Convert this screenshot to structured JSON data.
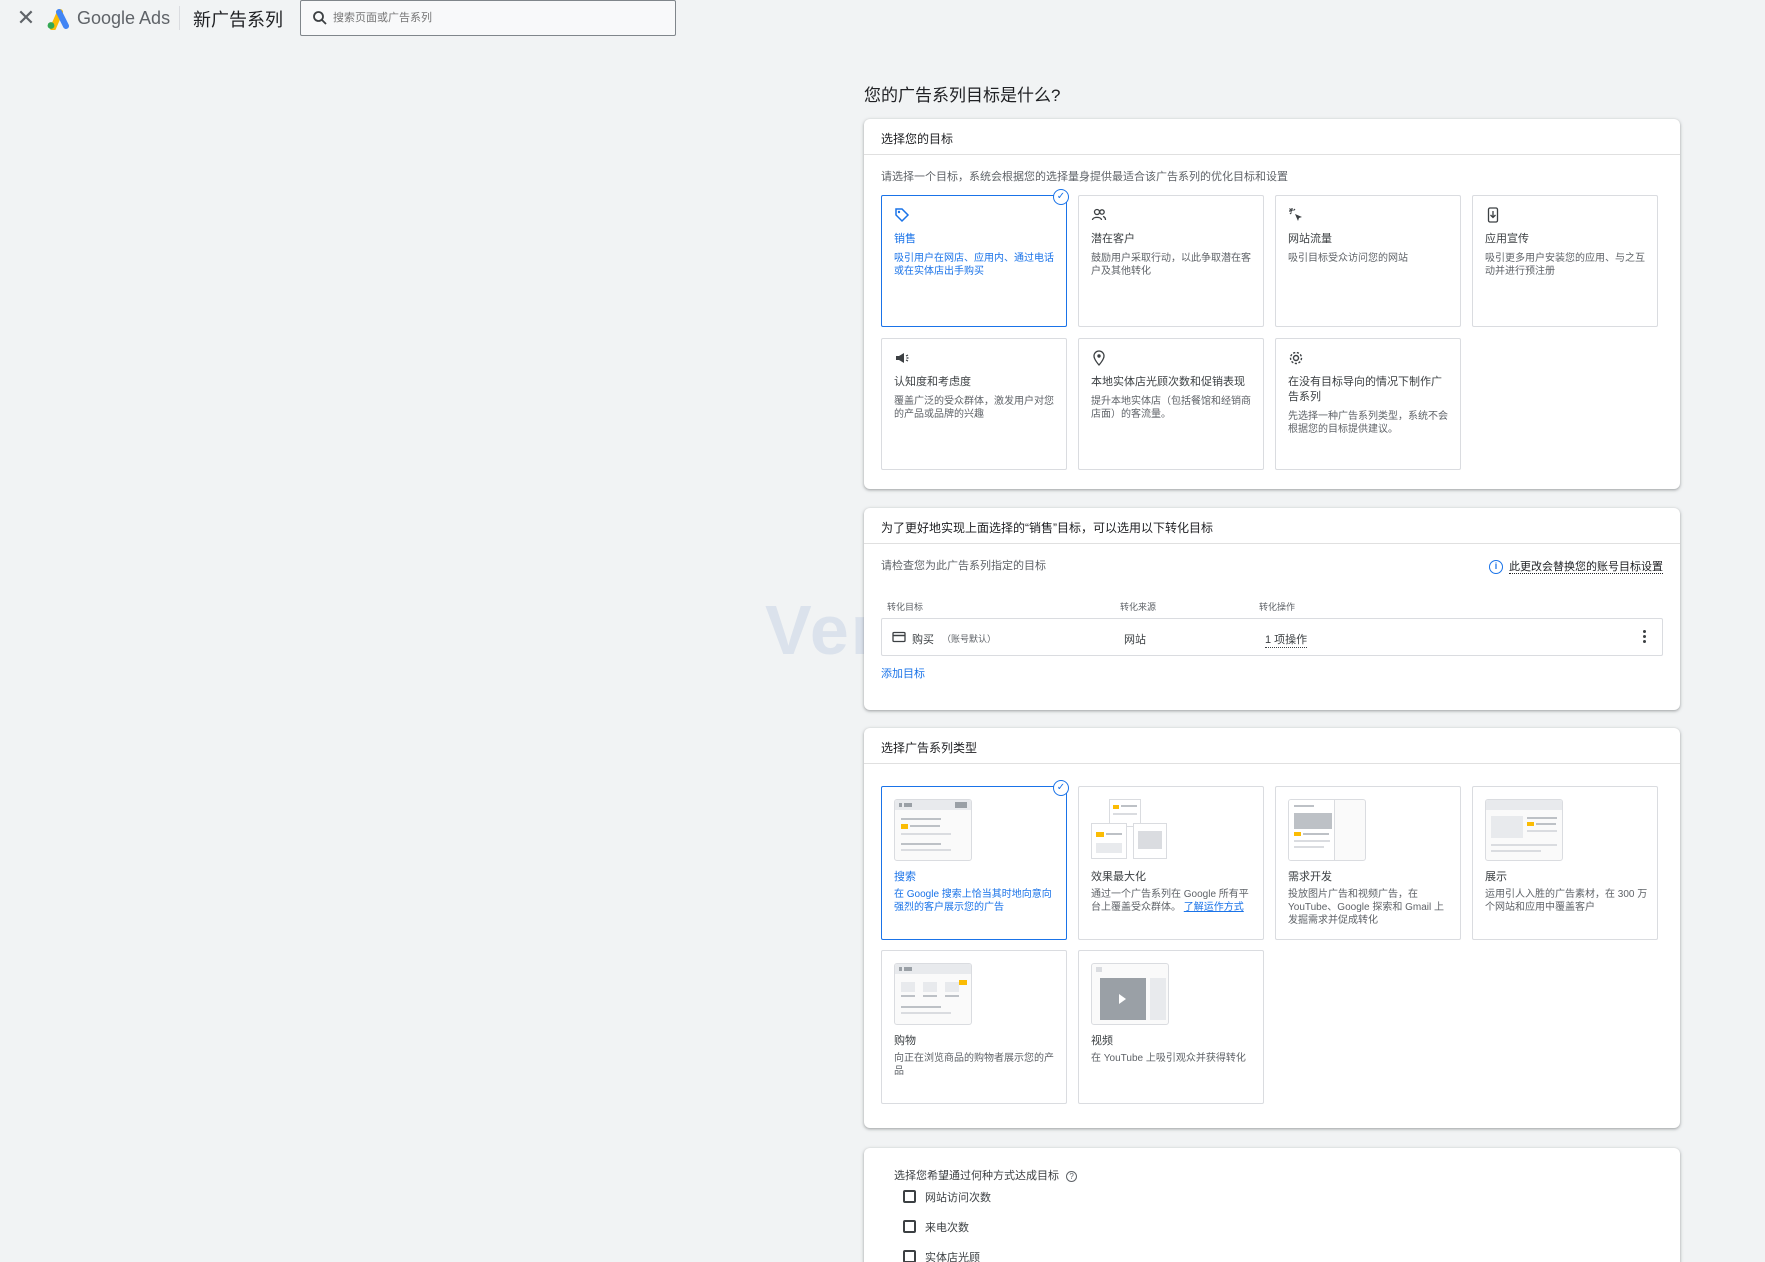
{
  "header": {
    "close_icon": "close-icon",
    "brand": "Google Ads",
    "page_title": "新广告系列",
    "search_placeholder": "搜索页面或广告系列"
  },
  "main_title": "您的广告系列目标是什么?",
  "goal_section": {
    "heading": "选择您的目标",
    "subtitle": "请选择一个目标，系统会根据您的选择量身提供最适合该广告系列的优化目标和设置",
    "tiles": [
      {
        "icon": "tag-icon",
        "title": "销售",
        "desc": "吸引用户在网店、应用内、通过电话或在实体店出手购买",
        "selected": true
      },
      {
        "icon": "people-icon",
        "title": "潜在客户",
        "desc": "鼓励用户采取行动，以此争取潜在客户及其他转化",
        "selected": false
      },
      {
        "icon": "click-icon",
        "title": "网站流量",
        "desc": "吸引目标受众访问您的网站",
        "selected": false
      },
      {
        "icon": "phone-download-icon",
        "title": "应用宣传",
        "desc": "吸引更多用户安装您的应用、与之互动并进行预注册",
        "selected": false
      },
      {
        "icon": "megaphone-icon",
        "title": "认知度和考虑度",
        "desc": "覆盖广泛的受众群体，激发用户对您的产品或品牌的兴趣",
        "selected": false
      },
      {
        "icon": "location-pin-icon",
        "title": "本地实体店光顾次数和促销表现",
        "desc": "提升本地实体店（包括餐馆和经销商店面）的客流量。",
        "selected": false
      },
      {
        "icon": "gear-icon",
        "title": "在没有目标导向的情况下制作广告系列",
        "desc": "先选择一种广告系列类型，系统不会根据您的目标提供建议。",
        "selected": false
      }
    ]
  },
  "conversion_section": {
    "heading": "为了更好地实现上面选择的“销售”目标，可以选用以下转化目标",
    "subtitle": "请检查您为此广告系列指定的目标",
    "info_text": "此更改会替换您的账号目标设置",
    "columns": [
      "转化目标",
      "转化来源",
      "转化操作"
    ],
    "row": {
      "goal": "购买",
      "goal_tag": "（账号默认）",
      "source": "网站",
      "action": "1 项操作"
    },
    "add_link": "添加目标"
  },
  "type_section": {
    "heading": "选择广告系列类型",
    "tiles": [
      {
        "title": "搜索",
        "desc": "在 Google 搜索上恰当其时地向意向强烈的客户展示您的广告",
        "selected": true,
        "thumb": "search"
      },
      {
        "title": "效果最大化",
        "desc": "通过一个广告系列在 Google 所有平台上覆盖受众群体。",
        "link": "了解运作方式",
        "selected": false,
        "thumb": "pmax"
      },
      {
        "title": "需求开发",
        "desc": "投放图片广告和视频广告，在 YouTube、Google 探索和 Gmail 上发掘需求并促成转化",
        "selected": false,
        "thumb": "demand"
      },
      {
        "title": "展示",
        "desc": "运用引人入胜的广告素材，在 300 万个网站和应用中覆盖客户",
        "selected": false,
        "thumb": "display"
      },
      {
        "title": "购物",
        "desc": "向正在浏览商品的购物者展示您的产品",
        "selected": false,
        "thumb": "shopping"
      },
      {
        "title": "视频",
        "desc": "在 YouTube 上吸引观众并获得转化",
        "selected": false,
        "thumb": "video"
      }
    ]
  },
  "reach_section": {
    "label": "选择您希望通过何种方式达成目标",
    "help_icon": "help-icon",
    "options": [
      "网站访问次数",
      "来电次数",
      "实体店光顾"
    ]
  },
  "watermark": "VeryFb",
  "colors": {
    "accent": "#1a73e8",
    "background": "#f1f3f4",
    "card": "#ffffff",
    "border": "#dadce0"
  }
}
